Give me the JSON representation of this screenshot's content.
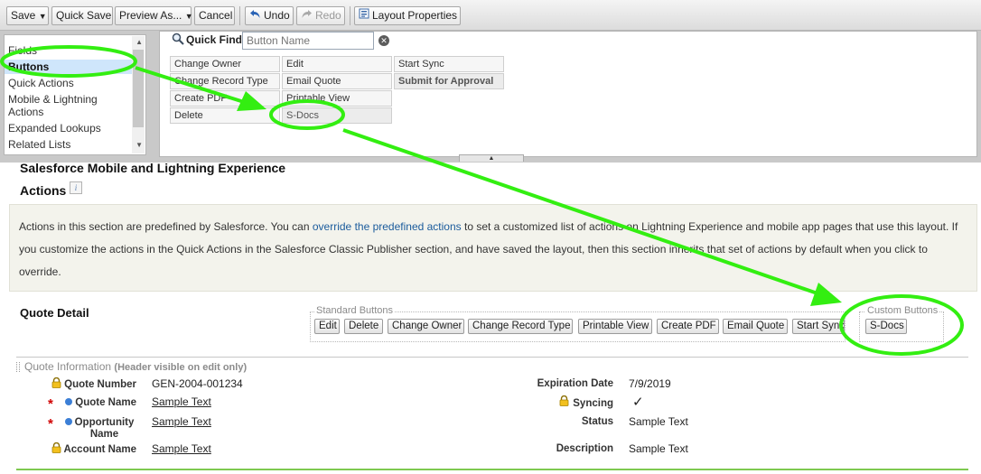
{
  "toolbar": {
    "save": "Save",
    "quick_save": "Quick Save",
    "preview_as": "Preview As...",
    "cancel": "Cancel",
    "undo": "Undo",
    "redo": "Redo",
    "layout_properties": "Layout Properties"
  },
  "palette": {
    "categories": [
      "Fields",
      "Buttons",
      "Quick Actions",
      "Mobile & Lightning Actions",
      "Expanded Lookups",
      "Related Lists"
    ],
    "active_category": "Buttons",
    "quick_find_label": "Quick Find",
    "quick_find_placeholder": "Button Name",
    "items": {
      "col1": [
        "Change Owner",
        "Change Record Type",
        "Create PDF",
        "Delete"
      ],
      "col2": [
        "Edit",
        "Email Quote",
        "Printable View",
        "S-Docs"
      ],
      "col3": [
        "Start Sync",
        "Submit for Approval"
      ]
    }
  },
  "page": {
    "mobile_heading": "Salesforce Mobile and Lightning Experience",
    "actions_heading": "Actions",
    "info_icon": "i",
    "notice_pre": "Actions in this section are predefined by Salesforce. You can ",
    "notice_link": "override the predefined actions",
    "notice_post": " to set a customized list of actions on Lightning Experience and mobile app pages that use this layout. If you customize the actions in the Quick Actions in the Salesforce Classic Publisher section, and have saved the layout, then this section inherits that set of actions by default when you click to override.",
    "quote_detail": "Quote Detail",
    "standard_buttons_legend": "Standard Buttons",
    "standard_buttons": [
      "Edit",
      "Delete",
      "Change Owner",
      "Change Record Type",
      "Printable View",
      "Create PDF",
      "Email Quote",
      "Start Sync"
    ],
    "custom_buttons_legend": "Custom Buttons",
    "custom_buttons": [
      "S-Docs"
    ],
    "section_title": "Quote Information",
    "section_subtitle": "(Header visible on edit only)",
    "left_fields": [
      {
        "label": "Quote Number",
        "value": "GEN-2004-001234"
      },
      {
        "label": "Quote Name",
        "value": "Sample Text"
      },
      {
        "label": "Opportunity Name",
        "value": "Sample Text"
      },
      {
        "label": "Account Name",
        "value": "Sample Text"
      }
    ],
    "right_fields": [
      {
        "label": "Expiration Date",
        "value": "7/9/2019"
      },
      {
        "label": "Syncing",
        "value": "✓"
      },
      {
        "label": "Status",
        "value": "Sample Text"
      },
      {
        "label": "Description",
        "value": "Sample Text"
      }
    ]
  },
  "colors": {
    "annotation": "#33ee11",
    "active_category": "#cfe6fb",
    "link": "#1a5b9c",
    "required": "#d00000"
  }
}
